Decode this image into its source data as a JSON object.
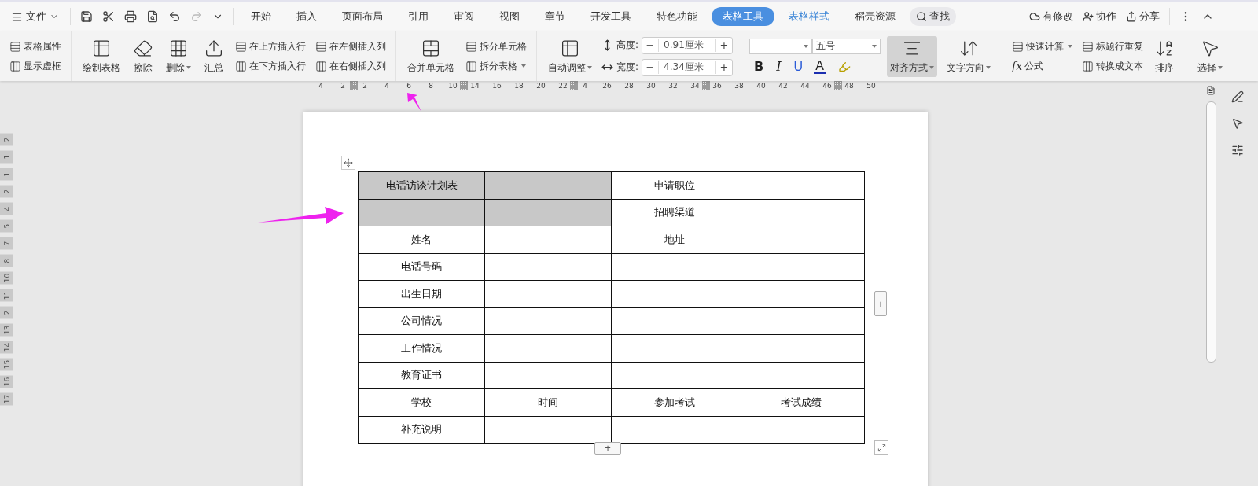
{
  "menu_bar": {
    "file": "文件",
    "tabs": [
      {
        "label": "开始",
        "selected": false
      },
      {
        "label": "插入",
        "selected": false
      },
      {
        "label": "页面布局",
        "selected": false
      },
      {
        "label": "引用",
        "selected": false
      },
      {
        "label": "审阅",
        "selected": false
      },
      {
        "label": "视图",
        "selected": false
      },
      {
        "label": "章节",
        "selected": false
      },
      {
        "label": "开发工具",
        "selected": false
      },
      {
        "label": "特色功能",
        "selected": false
      },
      {
        "label": "表格工具",
        "selected": true
      },
      {
        "label": "表格样式",
        "selected": false
      },
      {
        "label": "稻壳资源",
        "selected": false
      }
    ],
    "search": "查找",
    "actions": [
      "有修改",
      "协作",
      "分享"
    ]
  },
  "ribbon": {
    "groups": [
      {
        "columns": [
          {
            "kind": "stack",
            "items": [
              {
                "label": "表格属性"
              },
              {
                "label": "显示虚框"
              }
            ]
          }
        ]
      },
      {
        "columns": [
          {
            "kind": "large",
            "label": "绘制表格"
          },
          {
            "kind": "large",
            "label": "擦除"
          },
          {
            "kind": "large",
            "label": "删除",
            "dropdown": true
          },
          {
            "kind": "large",
            "label": "汇总"
          },
          {
            "kind": "stack",
            "items": [
              {
                "label": "在上方插入行"
              },
              {
                "label": "在下方插入行"
              }
            ]
          },
          {
            "kind": "stack",
            "items": [
              {
                "label": "在左侧插入列"
              },
              {
                "label": "在右侧插入列"
              }
            ]
          }
        ]
      },
      {
        "columns": [
          {
            "kind": "large",
            "label": "合并单元格"
          },
          {
            "kind": "stack",
            "items": [
              {
                "label": "拆分单元格"
              },
              {
                "label": "拆分表格",
                "dropdown": true
              }
            ]
          }
        ]
      },
      {
        "columns": [
          {
            "kind": "large",
            "label": "自动调整",
            "dropdown": true
          },
          {
            "kind": "spinners",
            "items": [
              {
                "label": "高度:",
                "minus": "−",
                "value": "0.91厘米",
                "plus": "+"
              },
              {
                "label": "宽度:",
                "minus": "−",
                "value": "4.34厘米",
                "plus": "+"
              }
            ]
          }
        ]
      },
      {
        "columns": [
          {
            "kind": "font",
            "size": "五号",
            "bold": "B",
            "italic": "I",
            "underline": "U",
            "font_color": "A"
          },
          {
            "kind": "large",
            "label": "对齐方式",
            "dropdown": true,
            "selected": true
          },
          {
            "kind": "large",
            "label": "文字方向",
            "dropdown": true
          }
        ]
      },
      {
        "columns": [
          {
            "kind": "stack",
            "items": [
              {
                "label": "快速计算",
                "dropdown": true
              },
              {
                "label": "公式",
                "prefix": "fx"
              }
            ]
          },
          {
            "kind": "stack",
            "items": [
              {
                "label": "标题行重复"
              },
              {
                "label": "转换成文本"
              }
            ]
          },
          {
            "kind": "large",
            "label": "排序"
          }
        ]
      },
      {
        "columns": [
          {
            "kind": "large",
            "label": "选择",
            "dropdown": true
          }
        ]
      }
    ]
  },
  "ruler": {
    "horizontal": [
      {
        "label": "4"
      },
      {
        "label": "2"
      },
      {
        "kind": "marker"
      },
      {
        "label": "2"
      },
      {
        "label": "4"
      },
      {
        "label": "6"
      },
      {
        "label": "8"
      },
      {
        "label": "10"
      },
      {
        "kind": "marker"
      },
      {
        "label": "14"
      },
      {
        "label": "16"
      },
      {
        "label": "18"
      },
      {
        "label": "20"
      },
      {
        "label": "22"
      },
      {
        "kind": "marker"
      },
      {
        "label": "4"
      },
      {
        "label": "26"
      },
      {
        "label": "28"
      },
      {
        "label": "30"
      },
      {
        "label": "32"
      },
      {
        "label": "34"
      },
      {
        "kind": "marker"
      },
      {
        "label": "36"
      },
      {
        "label": "38"
      },
      {
        "label": "40"
      },
      {
        "label": "42"
      },
      {
        "label": "44"
      },
      {
        "label": "46"
      },
      {
        "kind": "marker"
      },
      {
        "label": "48"
      },
      {
        "label": "50"
      }
    ],
    "vertical": [
      "2",
      "1",
      "1",
      "2",
      "4",
      "5",
      "7",
      "8",
      "10",
      "11",
      "2",
      "13",
      "14",
      "15",
      "16",
      "17"
    ]
  },
  "table": {
    "rows": [
      {
        "cells": [
          {
            "text": "电话访谈计划表",
            "shaded": true
          },
          {
            "shaded": true
          },
          {
            "text": "申请职位",
            "shaded": false
          },
          {
            "shaded": false
          }
        ]
      },
      {
        "cells": [
          {
            "shaded": true
          },
          {
            "shaded": true
          },
          {
            "text": "招聘渠道",
            "shaded": false
          },
          {
            "shaded": false
          }
        ]
      },
      {
        "cells": [
          {
            "text": "姓名",
            "shaded": false
          },
          {
            "shaded": false
          },
          {
            "text": "地址",
            "shaded": false
          },
          {
            "shaded": false
          }
        ]
      },
      {
        "cells": [
          {
            "text": "电话号码",
            "shaded": false
          },
          {
            "shaded": false
          },
          {
            "shaded": false
          },
          {
            "shaded": false
          }
        ]
      },
      {
        "cells": [
          {
            "text": "出生日期",
            "shaded": false
          },
          {
            "shaded": false
          },
          {
            "shaded": false
          },
          {
            "shaded": false
          }
        ]
      },
      {
        "cells": [
          {
            "text": "公司情况",
            "shaded": false
          },
          {
            "shaded": false
          },
          {
            "shaded": false
          },
          {
            "shaded": false
          }
        ]
      },
      {
        "cells": [
          {
            "text": "工作情况",
            "shaded": false
          },
          {
            "shaded": false
          },
          {
            "shaded": false
          },
          {
            "shaded": false
          }
        ]
      },
      {
        "cells": [
          {
            "text": "教育证书",
            "shaded": false
          },
          {
            "shaded": false
          },
          {
            "shaded": false
          },
          {
            "shaded": false
          }
        ]
      },
      {
        "cells": [
          {
            "text": "学校",
            "shaded": false
          },
          {
            "text": "时间",
            "shaded": false
          },
          {
            "text": "参加考试",
            "shaded": false
          },
          {
            "text": "考试成绩",
            "shaded": false
          }
        ]
      },
      {
        "cells": [
          {
            "text": "补充说明",
            "shaded": false
          },
          {
            "shaded": false
          },
          {
            "shaded": false
          },
          {
            "shaded": false
          }
        ]
      }
    ],
    "add_column": "+",
    "add_row": "+"
  }
}
